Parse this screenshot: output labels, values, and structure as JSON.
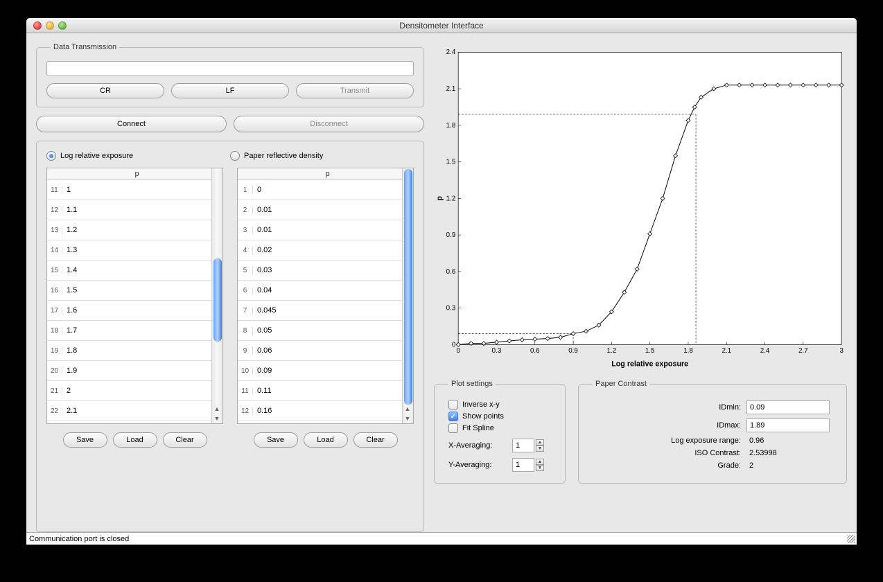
{
  "window": {
    "title": "Densitometer Interface"
  },
  "transmission": {
    "legend": "Data Transmission",
    "input_value": "",
    "cr": "CR",
    "lf": "LF",
    "transmit": "Transmit"
  },
  "connection": {
    "connect": "Connect",
    "disconnect": "Disconnect"
  },
  "tables": {
    "left_radio": "Log relative exposure",
    "right_radio": "Paper reflective density",
    "header": "p",
    "left": {
      "start_index": 11,
      "rows": [
        "1",
        "1.1",
        "1.2",
        "1.3",
        "1.4",
        "1.5",
        "1.6",
        "1.7",
        "1.8",
        "1.9",
        "2",
        "2.1"
      ]
    },
    "right": {
      "start_index": 1,
      "rows": [
        "0",
        "0.01",
        "0.01",
        "0.02",
        "0.03",
        "0.04",
        "0.045",
        "0.05",
        "0.06",
        "0.09",
        "0.11",
        "0.16"
      ]
    },
    "save": "Save",
    "load": "Load",
    "clear": "Clear"
  },
  "plot_settings": {
    "legend": "Plot settings",
    "inverse": "Inverse x-y",
    "show_points": "Show points",
    "fit_spline": "Fit Spline",
    "x_avg_label": "X-Averaging:",
    "x_avg": "1",
    "y_avg_label": "Y-Averaging:",
    "y_avg": "1"
  },
  "paper_contrast": {
    "legend": "Paper Contrast",
    "idmin_label": "IDmin:",
    "idmin": "0.09",
    "idmax_label": "IDmax:",
    "idmax": "1.89",
    "range_label": "Log exposure range:",
    "range": "0.96",
    "iso_label": "ISO Contrast:",
    "iso": "2.53998",
    "grade_label": "Grade:",
    "grade": "2"
  },
  "status": "Communication port is closed",
  "chart_data": {
    "type": "line",
    "xlabel": "Log relative exposure",
    "ylabel": "p",
    "xlim": [
      0,
      3
    ],
    "ylim": [
      0,
      2.4
    ],
    "xticks": [
      0,
      0.3,
      0.6,
      0.9,
      1.2,
      1.5,
      1.8,
      2.1,
      2.4,
      2.7,
      3
    ],
    "yticks": [
      0,
      0.3,
      0.6,
      0.9,
      1.2,
      1.5,
      1.8,
      2.1,
      2.4
    ],
    "x": [
      0,
      0.1,
      0.2,
      0.3,
      0.4,
      0.5,
      0.6,
      0.7,
      0.8,
      0.9,
      1.0,
      1.1,
      1.2,
      1.3,
      1.4,
      1.5,
      1.6,
      1.7,
      1.8,
      1.85,
      1.9,
      2.0,
      2.1,
      2.2,
      2.3,
      2.4,
      2.5,
      2.6,
      2.7,
      2.8,
      2.9,
      3.0
    ],
    "y": [
      0,
      0.01,
      0.01,
      0.02,
      0.03,
      0.04,
      0.045,
      0.05,
      0.06,
      0.09,
      0.11,
      0.16,
      0.27,
      0.43,
      0.62,
      0.91,
      1.2,
      1.55,
      1.84,
      1.95,
      2.03,
      2.1,
      2.13,
      2.13,
      2.13,
      2.13,
      2.13,
      2.13,
      2.13,
      2.13,
      2.13,
      2.13
    ],
    "guides": {
      "x_left": 0.9,
      "x_right": 1.86,
      "y_low": 0.09,
      "y_high": 1.89
    }
  }
}
